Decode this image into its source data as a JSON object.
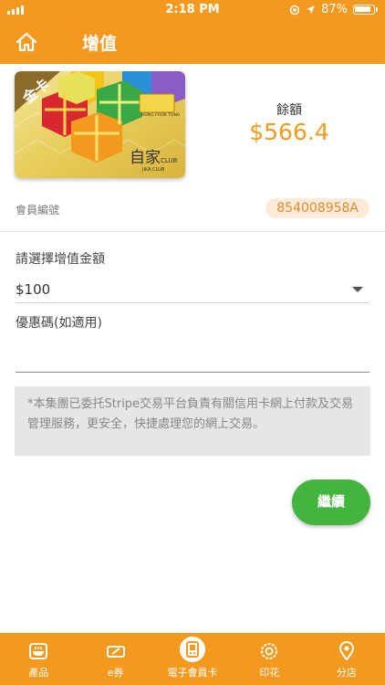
{
  "status_bar": {
    "time": "2:18 PM",
    "battery": "87%"
  },
  "header": {
    "title": "增值"
  },
  "card": {
    "badge": "金卡",
    "brand_cn": "自家",
    "brand_en": "CLUB",
    "brand_sub": "JIKA CLUB",
    "logo_text": "HONG FOOK TONG"
  },
  "balance": {
    "label": "餘額",
    "value": "$566.4"
  },
  "member": {
    "label": "會員編號",
    "value": "854008958A"
  },
  "topup": {
    "select_label": "請選擇增值金額",
    "amount": "$100",
    "promo_label": "優惠碼(如適用)",
    "promo_value": "",
    "notice": "*本集團已委托Stripe交易平台負責有關信用卡網上付款及交易管理服務，更安全，快捷處理您的網上交易。",
    "continue_label": "繼續"
  },
  "tabs": [
    {
      "label": "產品",
      "icon": "bowl-icon"
    },
    {
      "label": "e券",
      "icon": "ticket-icon"
    },
    {
      "label": "電子會員卡",
      "icon": "qr-card-icon"
    },
    {
      "label": "印花",
      "icon": "stamp-icon"
    },
    {
      "label": "分店",
      "icon": "location-pin-icon"
    }
  ],
  "colors": {
    "brand_orange": "#f39a1e",
    "continue_green": "#43b53f",
    "chip_bg": "#fdebd9"
  }
}
